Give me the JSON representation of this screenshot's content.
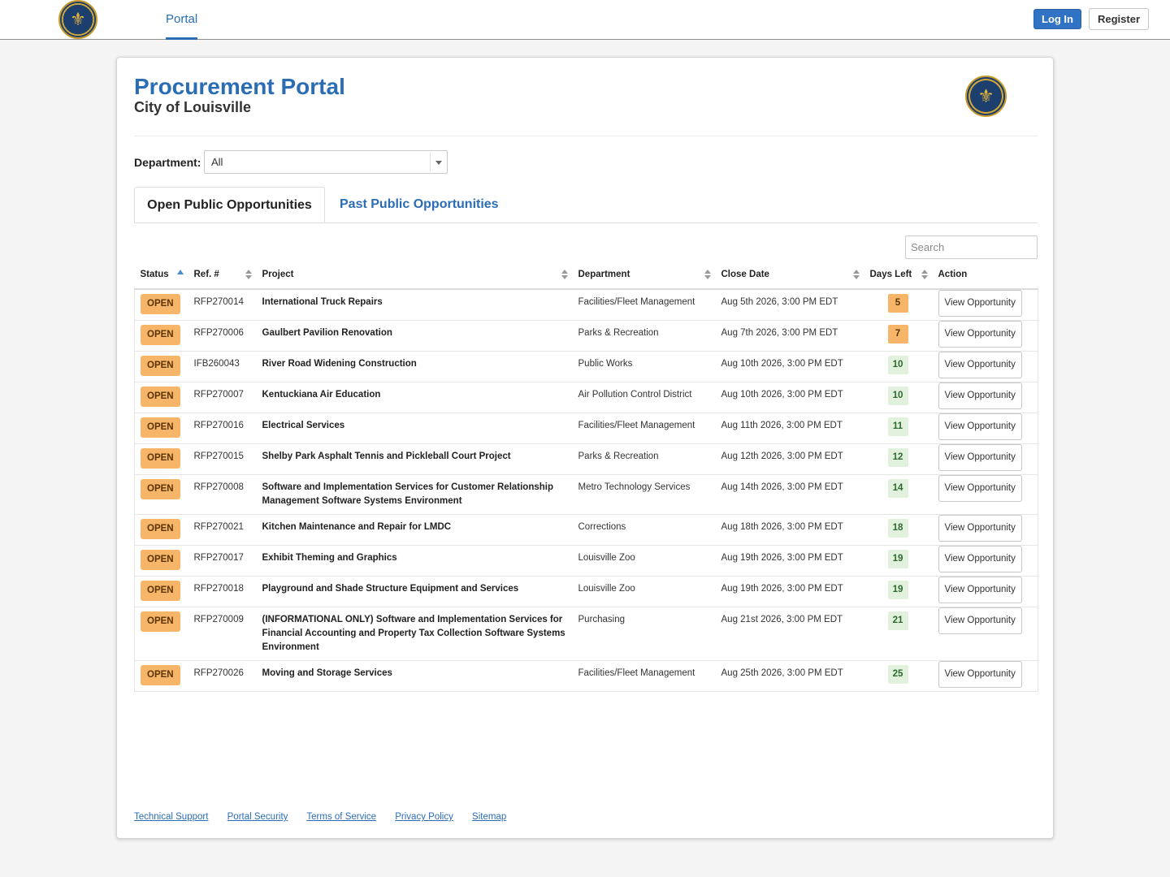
{
  "nav": {
    "portal_label": "Portal",
    "login_label": "Log In",
    "register_label": "Register"
  },
  "header": {
    "title": "Procurement Portal",
    "subtitle": "City of Louisville"
  },
  "filter": {
    "department_label": "Department:",
    "department_value": "All"
  },
  "tabs": [
    {
      "label": "Open Public Opportunities",
      "active": true
    },
    {
      "label": "Past Public Opportunities",
      "active": false
    }
  ],
  "search": {
    "placeholder": "Search"
  },
  "table": {
    "columns": [
      "Status",
      "Ref. #",
      "Project",
      "Department",
      "Close Date",
      "Days Left",
      "Action"
    ],
    "rows": [
      {
        "status": "OPEN",
        "ref": "RFP270014",
        "project": "International Truck Repairs",
        "department": "Facilities/Fleet Management",
        "close_date": "Aug 5th 2026, 3:00 PM EDT",
        "days_left": "5",
        "action": "View Opportunity"
      },
      {
        "status": "OPEN",
        "ref": "RFP270006",
        "project": "Gaulbert Pavilion Renovation",
        "department": "Parks & Recreation",
        "close_date": "Aug 7th 2026, 3:00 PM EDT",
        "days_left": "7",
        "action": "View Opportunity"
      },
      {
        "status": "OPEN",
        "ref": "IFB260043",
        "project": "River Road Widening Construction",
        "department": "Public Works",
        "close_date": "Aug 10th 2026, 3:00 PM EDT",
        "days_left": "10",
        "action": "View Opportunity"
      },
      {
        "status": "OPEN",
        "ref": "RFP270007",
        "project": "Kentuckiana Air Education",
        "department": "Air Pollution Control District",
        "close_date": "Aug 10th 2026, 3:00 PM EDT",
        "days_left": "10",
        "action": "View Opportunity"
      },
      {
        "status": "OPEN",
        "ref": "RFP270016",
        "project": "Electrical Services",
        "department": "Facilities/Fleet Management",
        "close_date": "Aug 11th 2026, 3:00 PM EDT",
        "days_left": "11",
        "action": "View Opportunity"
      },
      {
        "status": "OPEN",
        "ref": "RFP270015",
        "project": "Shelby Park Asphalt Tennis and Pickleball Court Project",
        "department": "Parks & Recreation",
        "close_date": "Aug 12th 2026, 3:00 PM EDT",
        "days_left": "12",
        "action": "View Opportunity"
      },
      {
        "status": "OPEN",
        "ref": "RFP270008",
        "project": "Software and Implementation Services for Customer Relationship Management Software Systems Environment",
        "department": "Metro Technology Services",
        "close_date": "Aug 14th 2026, 3:00 PM EDT",
        "days_left": "14",
        "action": "View Opportunity"
      },
      {
        "status": "OPEN",
        "ref": "RFP270021",
        "project": "Kitchen Maintenance and Repair for LMDC",
        "department": "Corrections",
        "close_date": "Aug 18th 2026, 3:00 PM EDT",
        "days_left": "18",
        "action": "View Opportunity"
      },
      {
        "status": "OPEN",
        "ref": "RFP270017",
        "project": "Exhibit Theming and Graphics",
        "department": "Louisville Zoo",
        "close_date": "Aug 19th 2026, 3:00 PM EDT",
        "days_left": "19",
        "action": "View Opportunity"
      },
      {
        "status": "OPEN",
        "ref": "RFP270018",
        "project": "Playground and Shade Structure Equipment and Services",
        "department": "Louisville Zoo",
        "close_date": "Aug 19th 2026, 3:00 PM EDT",
        "days_left": "19",
        "action": "View Opportunity"
      },
      {
        "status": "OPEN",
        "ref": "RFP270009",
        "project": "(INFORMATIONAL ONLY) Software and Implementation Services for Financial Accounting and Property Tax Collection Software Systems Environment",
        "department": "Purchasing",
        "close_date": "Aug 21st 2026, 3:00 PM EDT",
        "days_left": "21",
        "action": "View Opportunity"
      },
      {
        "status": "OPEN",
        "ref": "RFP270026",
        "project": "Moving and Storage Services",
        "department": "Facilities/Fleet Management",
        "close_date": "Aug 25th 2026, 3:00 PM EDT",
        "days_left": "25",
        "action": "View Opportunity"
      }
    ]
  },
  "footer": {
    "links": [
      "Technical Support",
      "Portal Security",
      "Terms of Service",
      "Privacy Policy",
      "Sitemap"
    ]
  },
  "colors": {
    "brand_blue": "#2a6db5",
    "status_open": "#f7b569",
    "days_urgent": "#f7b569",
    "days_normal": "#e2f1de"
  },
  "icons": [
    "louisville-seal-logo",
    "sort-icon",
    "sort-ascending-icon",
    "dropdown-caret-icon"
  ]
}
